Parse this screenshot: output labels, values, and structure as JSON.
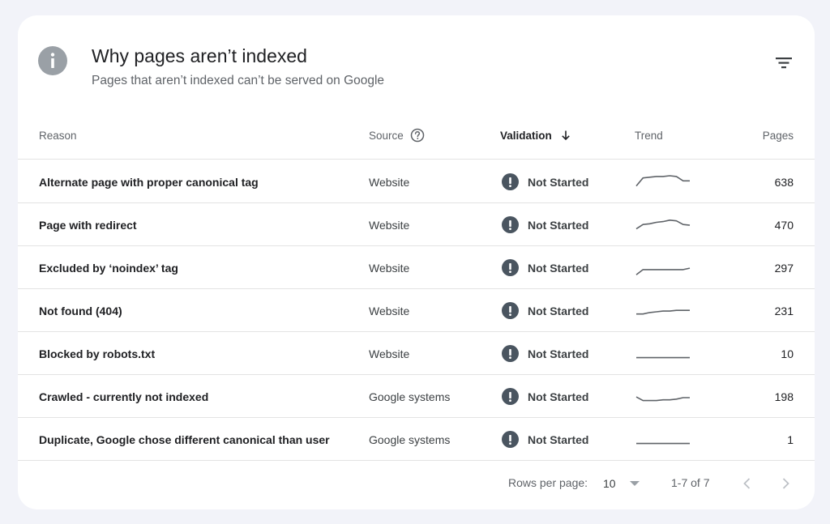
{
  "header": {
    "icon": "info-icon",
    "title": "Why pages aren’t indexed",
    "subtitle": "Pages that aren’t indexed can’t be served on Google",
    "filter_icon": "filter-icon"
  },
  "table": {
    "columns": {
      "reason": "Reason",
      "source": "Source",
      "validation": "Validation",
      "trend": "Trend",
      "pages": "Pages"
    },
    "sort_icon": "arrow-down-icon",
    "help_icon": "help-circle-icon",
    "status_icon": "exclamation-circle-icon",
    "status_icon_color": "#4a5560",
    "rows": [
      {
        "reason": "Alternate page with proper canonical tag",
        "source": "Website",
        "validation": "Not Started",
        "pages": "638",
        "trend": [
          0.3,
          0.85,
          0.9,
          0.95,
          0.95,
          1.0,
          0.95,
          0.65,
          0.65
        ]
      },
      {
        "reason": "Page with redirect",
        "source": "Website",
        "validation": "Not Started",
        "pages": "470",
        "trend": [
          0.3,
          0.6,
          0.65,
          0.75,
          0.8,
          0.9,
          0.85,
          0.6,
          0.55
        ]
      },
      {
        "reason": "Excluded by ‘noindex’ tag",
        "source": "Website",
        "validation": "Not Started",
        "pages": "297",
        "trend": [
          0.1,
          0.45,
          0.45,
          0.45,
          0.45,
          0.45,
          0.45,
          0.45,
          0.55
        ]
      },
      {
        "reason": "Not found (404)",
        "source": "Website",
        "validation": "Not Started",
        "pages": "231",
        "trend": [
          0.35,
          0.35,
          0.45,
          0.5,
          0.55,
          0.55,
          0.6,
          0.6,
          0.6
        ]
      },
      {
        "reason": "Blocked by robots.txt",
        "source": "Website",
        "validation": "Not Started",
        "pages": "10",
        "trend": [
          0.3,
          0.3,
          0.3,
          0.3,
          0.3,
          0.3,
          0.3,
          0.3,
          0.3
        ]
      },
      {
        "reason": "Crawled - currently not indexed",
        "source": "Google systems",
        "validation": "Not Started",
        "pages": "198",
        "trend": [
          0.55,
          0.3,
          0.3,
          0.3,
          0.35,
          0.35,
          0.4,
          0.5,
          0.5
        ]
      },
      {
        "reason": "Duplicate, Google chose different canonical than user",
        "source": "Google systems",
        "validation": "Not Started",
        "pages": "1",
        "trend": [
          0.3,
          0.3,
          0.3,
          0.3,
          0.3,
          0.3,
          0.3,
          0.3,
          0.3
        ]
      }
    ]
  },
  "footer": {
    "rows_per_page_label": "Rows per page:",
    "rows_per_page_value": "10",
    "range": "1-7 of 7",
    "prev_icon": "chevron-left-icon",
    "next_icon": "chevron-right-icon"
  }
}
